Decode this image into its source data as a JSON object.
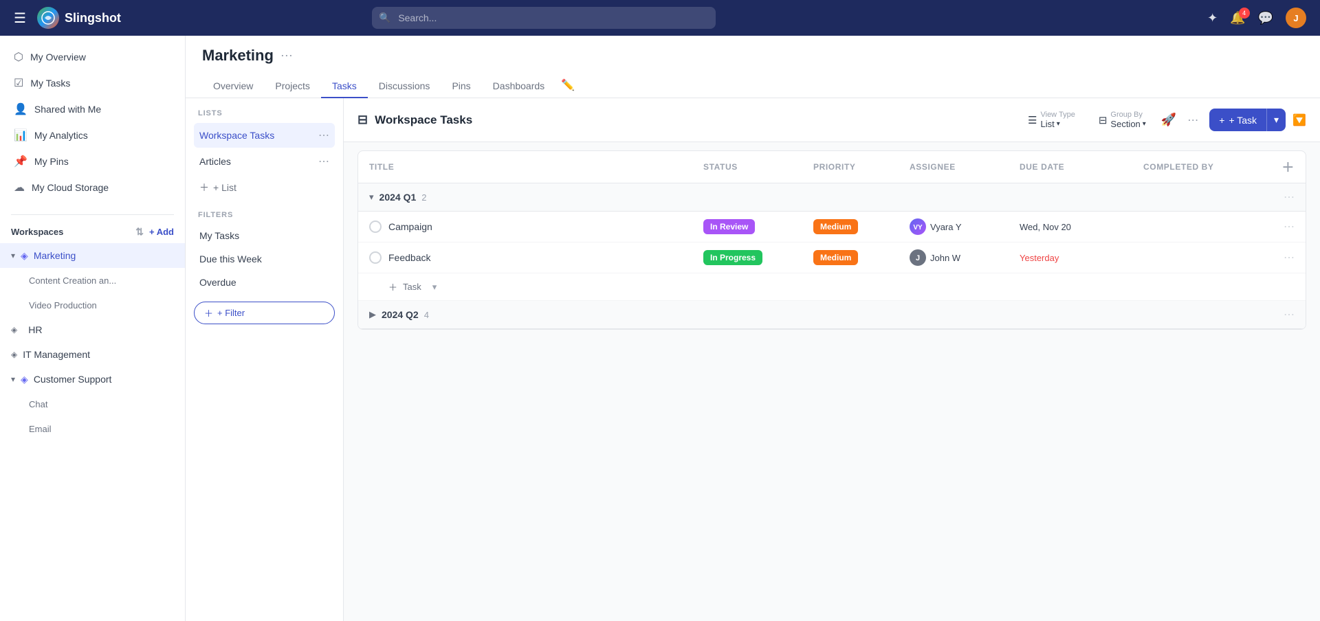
{
  "app": {
    "name": "Slingshot"
  },
  "topnav": {
    "search_placeholder": "Search...",
    "notification_count": "4",
    "user_initial": "J"
  },
  "sidebar": {
    "nav_items": [
      {
        "id": "my-overview",
        "label": "My Overview",
        "icon": "⬡"
      },
      {
        "id": "my-tasks",
        "label": "My Tasks",
        "icon": "☑"
      },
      {
        "id": "shared-with-me",
        "label": "Shared with Me",
        "icon": "👤"
      },
      {
        "id": "my-analytics",
        "label": "My Analytics",
        "icon": "📊"
      },
      {
        "id": "my-pins",
        "label": "My Pins",
        "icon": "📌"
      },
      {
        "id": "my-cloud-storage",
        "label": "My Cloud Storage",
        "icon": "☁"
      }
    ],
    "workspaces_label": "Workspaces",
    "workspaces": [
      {
        "id": "marketing",
        "label": "Marketing",
        "icon": "◈",
        "active": true,
        "expanded": true,
        "children": [
          {
            "id": "content-creation",
            "label": "Content Creation an..."
          },
          {
            "id": "video-production",
            "label": "Video Production"
          }
        ]
      },
      {
        "id": "hr",
        "label": "HR",
        "icon": "◈",
        "active": false,
        "expanded": false
      },
      {
        "id": "it-management",
        "label": "IT Management",
        "icon": "◈",
        "active": false,
        "expanded": false
      },
      {
        "id": "customer-support",
        "label": "Customer Support",
        "icon": "◈",
        "active": false,
        "expanded": true,
        "children": [
          {
            "id": "chat",
            "label": "Chat"
          },
          {
            "id": "email",
            "label": "Email"
          }
        ]
      }
    ]
  },
  "page": {
    "title": "Marketing",
    "tabs": [
      "Overview",
      "Projects",
      "Tasks",
      "Discussions",
      "Pins",
      "Dashboards"
    ],
    "active_tab": "Tasks"
  },
  "left_panel": {
    "lists_label": "LISTS",
    "lists": [
      {
        "id": "workspace-tasks",
        "label": "Workspace Tasks",
        "active": true
      },
      {
        "id": "articles",
        "label": "Articles",
        "active": false
      }
    ],
    "add_list_label": "+ List",
    "filters_label": "FILTERS",
    "filters": [
      {
        "id": "my-tasks",
        "label": "My Tasks"
      },
      {
        "id": "due-this-week",
        "label": "Due this Week"
      },
      {
        "id": "overdue",
        "label": "Overdue"
      }
    ],
    "add_filter_label": "+ Filter"
  },
  "task_area": {
    "title": "Workspace Tasks",
    "toolbar": {
      "view_type_label": "View Type",
      "view_type_value": "List",
      "group_by_label": "Group By",
      "group_by_value": "Section",
      "add_task_label": "+ Task"
    },
    "columns": {
      "title": "Title",
      "status": "Status",
      "priority": "Priority",
      "assignee": "Assignee",
      "due_date": "Due Date",
      "completed_by": "Completed By"
    },
    "sections": [
      {
        "id": "2024-q1",
        "label": "2024 Q1",
        "count": 2,
        "expanded": true,
        "tasks": [
          {
            "id": "campaign",
            "title": "Campaign",
            "status": "In Review",
            "status_class": "status-in-review",
            "priority": "Medium",
            "priority_class": "priority-medium",
            "assignee": "Vyara Y",
            "assignee_initials": "VY",
            "assignee_class": "av-vyara",
            "due_date": "Wed, Nov 20",
            "due_overdue": false,
            "completed_by": ""
          },
          {
            "id": "feedback",
            "title": "Feedback",
            "status": "In Progress",
            "status_class": "status-in-progress",
            "priority": "Medium",
            "priority_class": "priority-medium",
            "assignee": "John W",
            "assignee_initials": "J",
            "assignee_class": "av-john",
            "due_date": "Yesterday",
            "due_overdue": true,
            "completed_by": ""
          }
        ]
      },
      {
        "id": "2024-q2",
        "label": "2024 Q2",
        "count": 4,
        "expanded": false,
        "tasks": []
      }
    ]
  }
}
